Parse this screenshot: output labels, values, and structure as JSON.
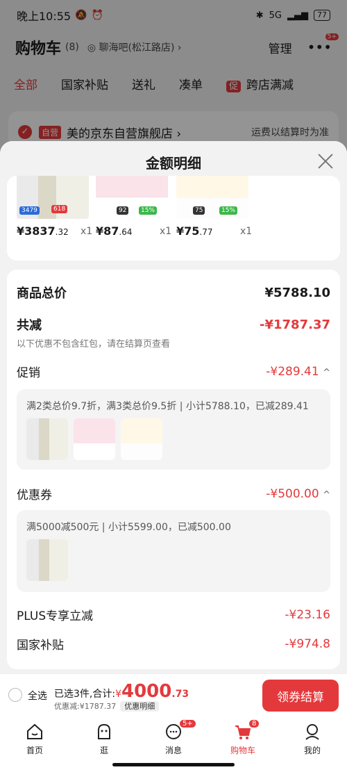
{
  "status_bar": {
    "time": "晚上10:55",
    "net": "5G",
    "battery": "77"
  },
  "cart_page": {
    "title": "购物车",
    "count": "(8)",
    "location": "聊海吧(松江路店)",
    "manage": "管理",
    "more_badge": "5+",
    "filters": [
      "全部",
      "国家补贴",
      "送礼",
      "凑单"
    ],
    "cross_store_tag": "促",
    "cross_store_label": "跨店满减",
    "shop_tag": "自营",
    "shop_name": "美的京东自营旗舰店",
    "shipping_note": "运费以结算时为准"
  },
  "sheet": {
    "title": "金额明细",
    "products": [
      {
        "price_int": "¥3837",
        "price_dec": ".32",
        "qty": "x1",
        "img_badge": "3479"
      },
      {
        "price_int": "¥87",
        "price_dec": ".64",
        "qty": "x1",
        "img_badge": "92"
      },
      {
        "price_int": "¥75",
        "price_dec": ".77",
        "qty": "x1",
        "img_badge": "75"
      }
    ],
    "total_label": "商品总价",
    "total_value": "¥5788.10",
    "reduce_label": "共减",
    "reduce_value": "-¥1787.37",
    "reduce_note": "以下优惠不包含红包，请在结算页查看",
    "promo_label": "促销",
    "promo_value": "-¥289.41",
    "promo_caret": "^",
    "promo_detail": "满2类总价9.7折，满3类总价9.5折 | 小计5788.10，已减289.41",
    "coupon_label": "优惠券",
    "coupon_value": "-¥500.00",
    "coupon_caret": "^",
    "coupon_detail": "满5000减500元 | 小计5599.00，已减500.00",
    "plus_label": "PLUS专享立减",
    "plus_value": "-¥23.16",
    "subsidy_label": "国家补贴",
    "subsidy_value": "-¥974.8"
  },
  "checkout": {
    "select_all": "全选",
    "summary_prefix": "已选3件,合计:",
    "currency": "¥",
    "total_int": "4000",
    "total_dec": ".73",
    "discount_line": "优惠减:¥1787.37",
    "detail_button": "优惠明细",
    "pay_button": "领券结算"
  },
  "tabs": [
    {
      "label": "首页",
      "icon": "home-icon"
    },
    {
      "label": "逛",
      "icon": "browse-icon"
    },
    {
      "label": "消息",
      "icon": "message-icon",
      "badge": "5+"
    },
    {
      "label": "购物车",
      "icon": "cart-icon",
      "badge": "8"
    },
    {
      "label": "我的",
      "icon": "profile-icon"
    }
  ],
  "colors": {
    "accent": "#e4393c",
    "sheet_bg": "#f2f2f2"
  }
}
